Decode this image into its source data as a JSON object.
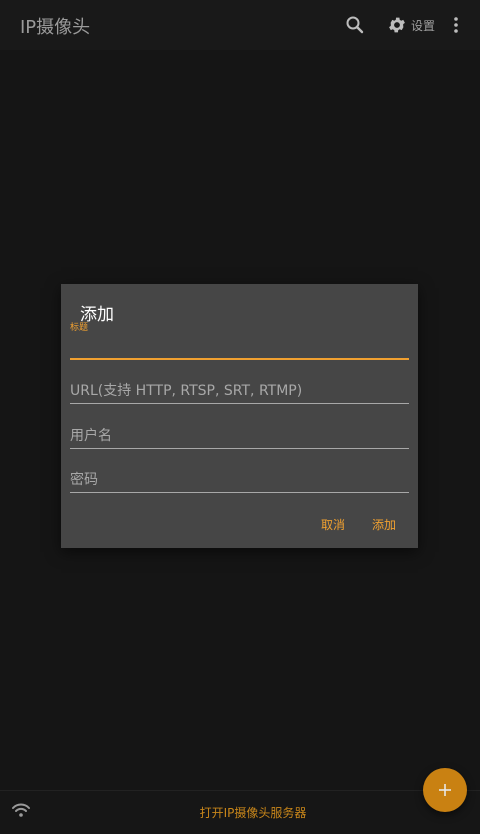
{
  "app": {
    "title": "IP摄像头",
    "settings_label": "设置"
  },
  "dialog": {
    "title": "添加",
    "fields": [
      {
        "label": "标题",
        "value": ""
      },
      {
        "placeholder": "URL(支持 HTTP, RTSP, SRT, RTMP)",
        "value": ""
      },
      {
        "placeholder": "用户名",
        "value": ""
      },
      {
        "placeholder": "密码",
        "value": ""
      }
    ],
    "cancel_label": "取消",
    "add_label": "添加"
  },
  "bottom": {
    "server_label": "打开IP摄像头服务器"
  },
  "icons": {
    "search": "search-icon",
    "settings": "gear-icon",
    "more": "more-vert-icon",
    "wifi": "wifi-icon",
    "fab": "plus-icon"
  },
  "colors": {
    "accent": "#f0a030",
    "fab": "#c98112",
    "dialog_bg": "#464646",
    "background": "#141414"
  }
}
